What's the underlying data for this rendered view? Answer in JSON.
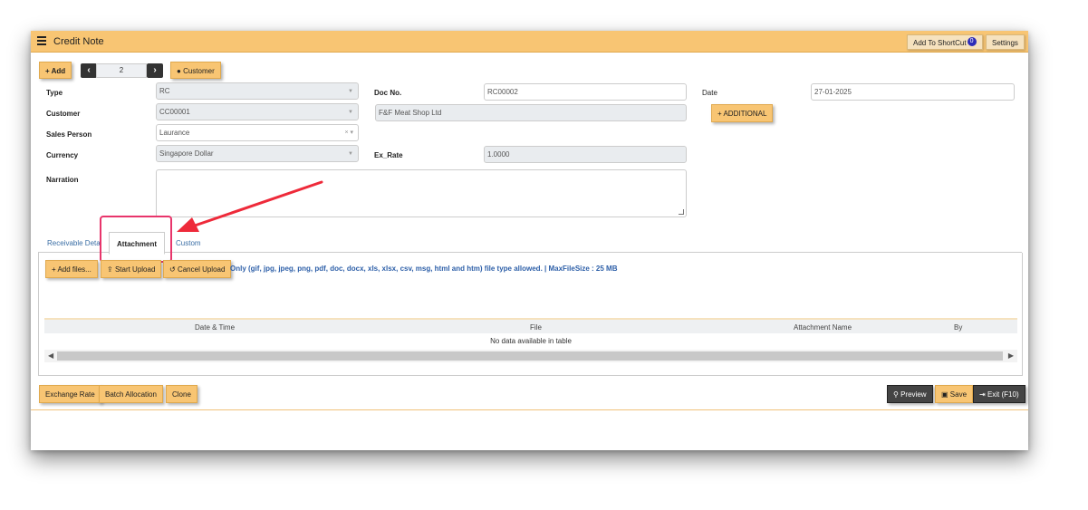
{
  "window": {
    "title": "Credit Note"
  },
  "toolbar": {
    "shortcut_label": "Add To ShortCut",
    "shortcut_count": "0",
    "settings_label": "Settings"
  },
  "actions": {
    "add_label": "+ Add",
    "page_value": "2",
    "prev_icon": "chevron-left-icon",
    "next_icon": "chevron-right-icon",
    "customer_label": "Customer"
  },
  "form": {
    "type_label": "Type",
    "type_value": "RC",
    "docno_label": "Doc No.",
    "docno_value": "RC00002",
    "date_label": "Date",
    "date_value": "27-01-2025",
    "customer_label": "Customer",
    "customer_code": "CC00001",
    "customer_name": "F&F Meat Shop Ltd",
    "additional_label": "+ ADDITIONAL",
    "salesperson_label": "Sales Person",
    "salesperson_value": "Laurance",
    "salesperson_clear": "× ▾",
    "currency_label": "Currency",
    "currency_value": "Singapore Dollar",
    "exrate_label": "Ex_Rate",
    "exrate_value": "1.0000",
    "narration_label": "Narration"
  },
  "tabs": [
    {
      "label": "Receivable Detail"
    },
    {
      "label": "Attachment"
    },
    {
      "label": "Custom"
    }
  ],
  "upload": {
    "add_files_label": "+ Add files...",
    "start_upload_label": "Start Upload",
    "cancel_upload_label": "Cancel Upload",
    "note": "Only (gif, jpg, jpeg, png, pdf, doc, docx, xls, xlsx, csv, msg, html and htm) file type allowed. | MaxFileSize : 25 MB"
  },
  "table": {
    "columns": [
      "Date & Time",
      "File",
      "Attachment Name",
      "By"
    ],
    "empty_text": "No data available in table"
  },
  "footer": {
    "exchange_rate_label": "Exchange Rate",
    "batch_allocation_label": "Batch Allocation",
    "clone_label": "Clone",
    "preview_label": "Preview",
    "save_label": "Save",
    "exit_label": "Exit (F10)"
  },
  "colors": {
    "header_bg": "#f8c573",
    "highlight": "#e8356b",
    "arrow": "#ee2a3a",
    "link": "#2d5fa8"
  }
}
